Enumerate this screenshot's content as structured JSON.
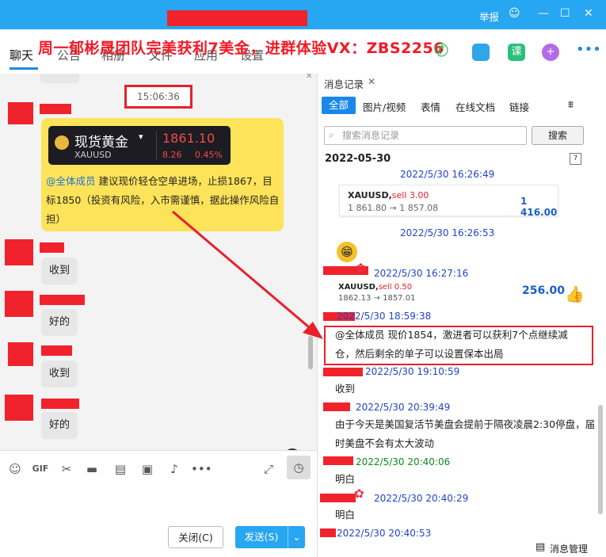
{
  "titlebar": {
    "report": "举报",
    "bg": "#27a6f1"
  },
  "promo": "周一郁彬晟团队完美获利7美金，进群体验VX：ZBS2256",
  "tabs": [
    "聊天",
    "公告",
    "相册",
    "文件",
    "应用",
    "设置"
  ],
  "chat": {
    "timestamp": "15:06:36",
    "gold": {
      "name": "现货黄金",
      "symbol": "XAUUSD",
      "price": "1861.10",
      "change": "8.26",
      "pct": "0.45%"
    },
    "yellow_msg_at": "@全体成员",
    "yellow_msg": " 建议现价轻仓空单进场，止损1867，目标1850（投资有风险，入市需谨慎，据此操作风险自担）",
    "replies": [
      "收到",
      "好的",
      "收到",
      "好的"
    ]
  },
  "buttons": {
    "close": "关闭(C)",
    "send": "发送(S)"
  },
  "right": {
    "header": "消息记录",
    "tabs": [
      "全部",
      "图片/视频",
      "表情",
      "在线文档",
      "链接"
    ],
    "search_placeholder": "搜索消息记录",
    "search_btn": "搜索",
    "date": "2022-05-30",
    "times": [
      "2022/5/30 16:26:49",
      "2022/5/30 16:26:53",
      "2022/5/30 16:27:16",
      "2022/5/30 18:59:38",
      "2022/5/30 19:10:59",
      "2022/5/30 20:39:49",
      "2022/5/30 20:40:06",
      "2022/5/30 20:40:29",
      "2022/5/30 20:40:53"
    ],
    "card1": {
      "sym": "XAUUSD,",
      "side": "sell 3.00",
      "range": "1 861.80 → 1 857.08",
      "profit": "1 416.00"
    },
    "card2": {
      "sym": "XAUUSD,",
      "side": "sell 0.50",
      "range": "1862.13 → 1857.01",
      "profit": "256.00"
    },
    "msg_highlight": "@全体成员 现价1854，激进者可以获利7个点继续减仓，然后剩余的单子可以设置保本出局",
    "msgs": [
      "收到",
      "由于今天是美国复活节美盘会提前于隔夜凌晨2:30停盘，届时美盘不会有太大波动",
      "明白",
      "明白"
    ],
    "manage": "消息管理"
  }
}
